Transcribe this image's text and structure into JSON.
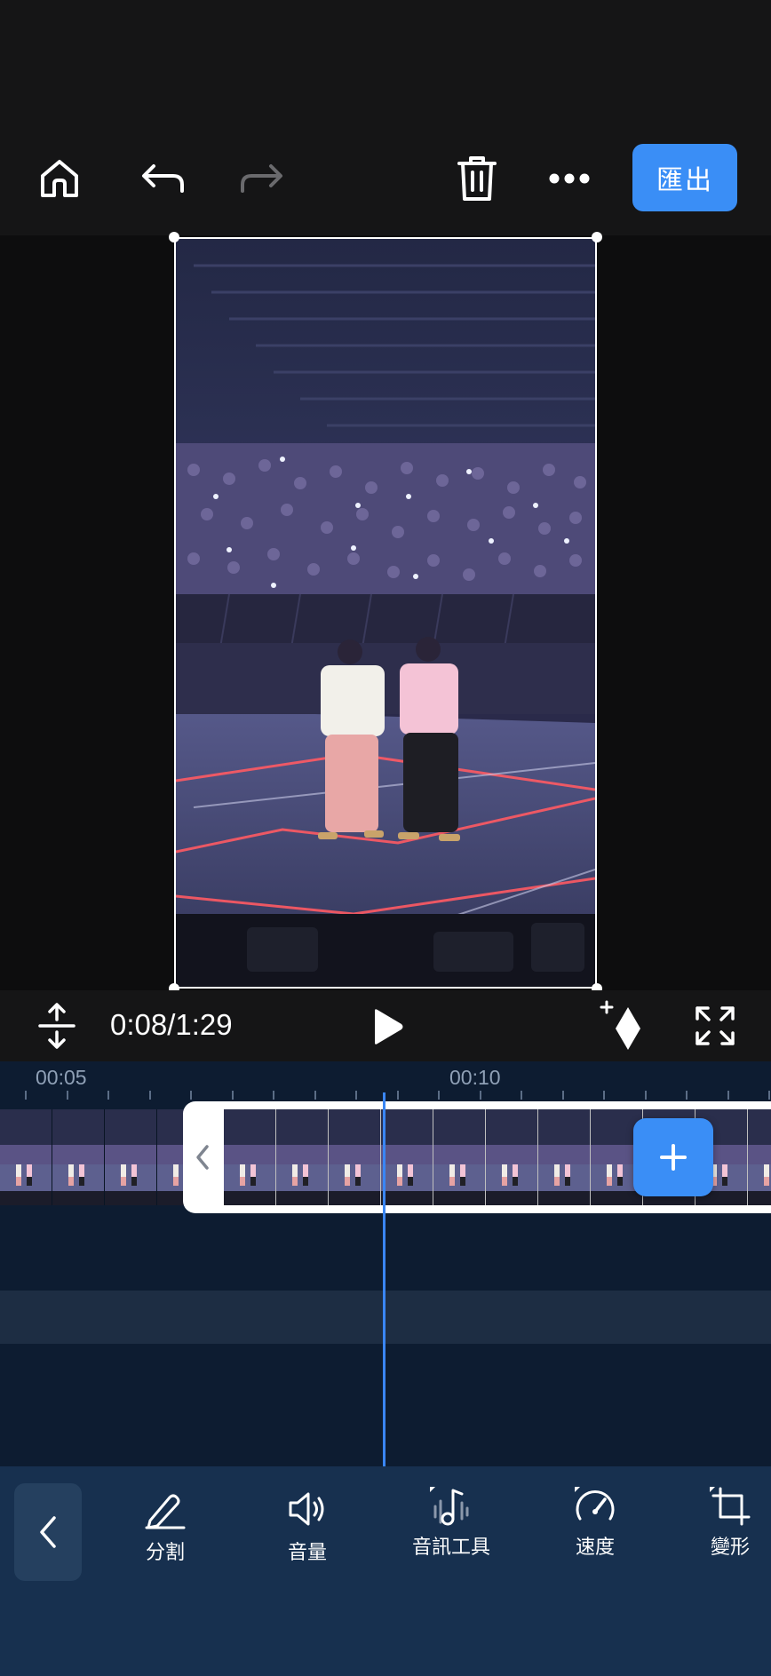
{
  "toolbar": {
    "export_label": "匯出"
  },
  "player": {
    "timecode": "0:08/1:29"
  },
  "timeline": {
    "ruler_labels": [
      "00:05",
      "00:10"
    ]
  },
  "tools": [
    {
      "label": "分割",
      "icon": "pen-split-icon"
    },
    {
      "label": "音量",
      "icon": "speaker-icon"
    },
    {
      "label": "音訊工具",
      "icon": "audio-tools-icon"
    },
    {
      "label": "速度",
      "icon": "speedometer-icon"
    },
    {
      "label": "變形",
      "icon": "crop-transform-icon"
    }
  ],
  "colors": {
    "accent": "#3a8ef6",
    "playhead": "#3a86f4",
    "timeline_bg": "#0d1c31",
    "tools_bg": "#17304f"
  }
}
